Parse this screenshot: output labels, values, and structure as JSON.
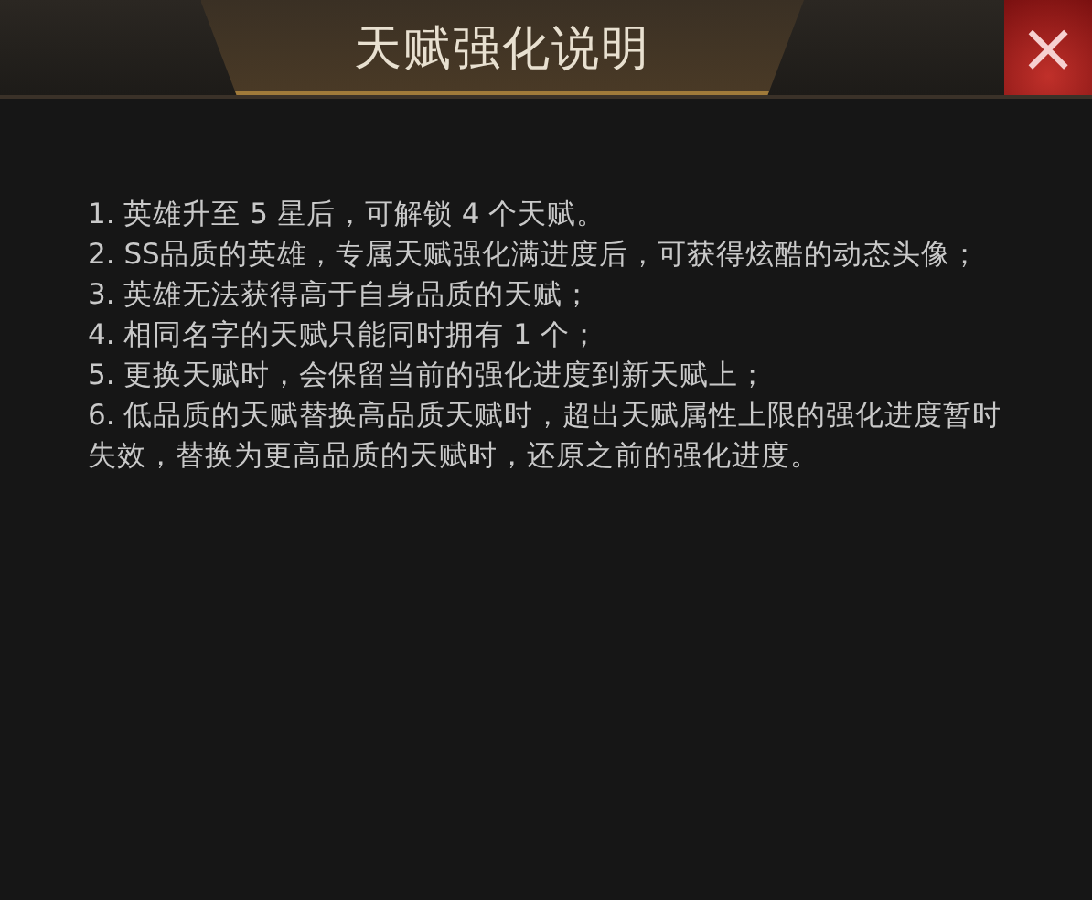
{
  "window": {
    "title": "天赋强化说明",
    "close": "×"
  },
  "notes": [
    "1. 英雄升至 5 星后，可解锁 4 个天赋。",
    "2. SS品质的英雄，专属天赋强化满进度后，可获得炫酷的动态头像；",
    "3. 英雄无法获得高于自身品质的天赋；",
    "4. 相同名字的天赋只能同时拥有 1 个；",
    "5. 更换天赋时，会保留当前的强化进度到新天赋上；",
    "6. 低品质的天赋替换高品质天赋时，超出天赋属性上限的强化进度暂时失效，替换为更高品质的天赋时，还原之前的强化进度。"
  ]
}
